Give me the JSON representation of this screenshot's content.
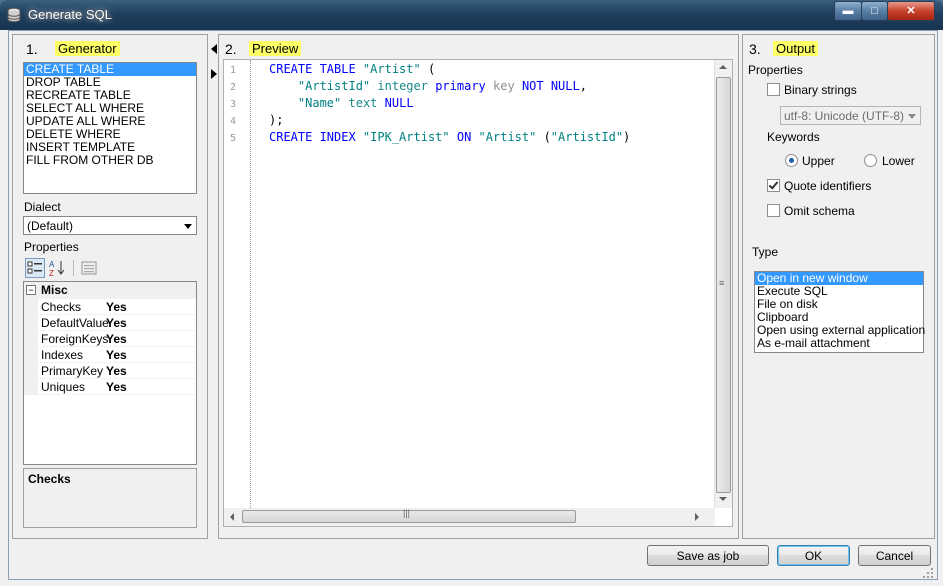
{
  "window": {
    "title": "Generate SQL"
  },
  "generator": {
    "step": "1.",
    "label": "Generator",
    "items": [
      "CREATE TABLE",
      "DROP TABLE",
      "RECREATE TABLE",
      "SELECT ALL WHERE",
      "UPDATE ALL WHERE",
      "DELETE WHERE",
      "INSERT TEMPLATE",
      "FILL FROM OTHER DB"
    ],
    "selected_index": 0,
    "dialect_label": "Dialect",
    "dialect_value": "(Default)",
    "properties_label": "Properties",
    "grid": {
      "category": "Misc",
      "rows": [
        {
          "name": "Checks",
          "value": "Yes"
        },
        {
          "name": "DefaultValue",
          "value": "Yes"
        },
        {
          "name": "ForeignKeys",
          "value": "Yes"
        },
        {
          "name": "Indexes",
          "value": "Yes"
        },
        {
          "name": "PrimaryKey",
          "value": "Yes"
        },
        {
          "name": "Uniques",
          "value": "Yes"
        }
      ]
    },
    "description_title": "Checks"
  },
  "preview": {
    "step": "2.",
    "label": "Preview",
    "line_numbers": [
      "1",
      "2",
      "3",
      "4",
      "5"
    ],
    "lines": [
      [
        [
          "kw",
          "CREATE TABLE "
        ],
        [
          "str",
          "\"Artist\""
        ],
        [
          "plain",
          " ("
        ]
      ],
      [
        [
          "plain",
          "    "
        ],
        [
          "str",
          "\"ArtistId\""
        ],
        [
          "plain",
          " "
        ],
        [
          "ty",
          "integer"
        ],
        [
          "plain",
          " "
        ],
        [
          "kw",
          "primary"
        ],
        [
          "plain",
          " "
        ],
        [
          "gray",
          "key"
        ],
        [
          "plain",
          " "
        ],
        [
          "kw",
          "NOT NULL"
        ],
        [
          "plain",
          ","
        ]
      ],
      [
        [
          "plain",
          "    "
        ],
        [
          "str",
          "\"Name\""
        ],
        [
          "plain",
          " "
        ],
        [
          "ty",
          "text"
        ],
        [
          "plain",
          " "
        ],
        [
          "kw",
          "NULL"
        ]
      ],
      [
        [
          "plain",
          ");"
        ]
      ],
      [
        [
          "kw",
          "CREATE INDEX "
        ],
        [
          "str",
          "\"IPK_Artist\""
        ],
        [
          "plain",
          " "
        ],
        [
          "kw",
          "ON"
        ],
        [
          "plain",
          " "
        ],
        [
          "str",
          "\"Artist\""
        ],
        [
          "plain",
          " ("
        ],
        [
          "str",
          "\"ArtistId\""
        ],
        [
          "plain",
          ")"
        ]
      ]
    ]
  },
  "output": {
    "step": "3.",
    "label": "Output",
    "properties_label": "Properties",
    "binary_strings": {
      "label": "Binary strings",
      "checked": false
    },
    "encoding_value": "utf-8: Unicode (UTF-8)",
    "keywords_label": "Keywords",
    "upper_label": "Upper",
    "lower_label": "Lower",
    "keywords_case": "Upper",
    "quote_identifiers": {
      "label": "Quote identifiers",
      "checked": true
    },
    "omit_schema": {
      "label": "Omit schema",
      "checked": false
    },
    "type_label": "Type",
    "type_items": [
      "Open in new window",
      "Execute SQL",
      "File on disk",
      "Clipboard",
      "Open using external application",
      "As e-mail attachment"
    ],
    "type_selected_index": 0
  },
  "buttons": {
    "save_as_job": "Save as job",
    "ok": "OK",
    "cancel": "Cancel"
  }
}
